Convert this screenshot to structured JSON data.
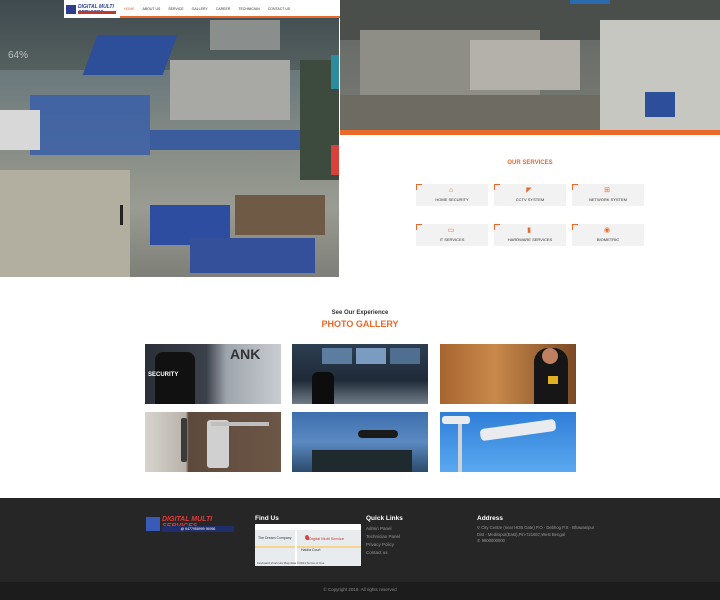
{
  "nav": {
    "logo_text": "DIGITAL MULTI SERVICES",
    "links": [
      "HOME",
      "ABOUT US",
      "SERVICE",
      "GALLERY",
      "CAREER",
      "TECHNICIAN",
      "CONTACT US"
    ]
  },
  "hero": {
    "slider_progress": "64%"
  },
  "services": {
    "title": "OUR SERVICES",
    "items": [
      {
        "label": "HOME SECURITY",
        "icon": "home-icon"
      },
      {
        "label": "CCTV SYSTEM",
        "icon": "cctv-icon"
      },
      {
        "label": "NETWORK SYSTEM",
        "icon": "network-icon"
      },
      {
        "label": "IT SERVICES",
        "icon": "monitor-icon"
      },
      {
        "label": "HARDWARE SERVICES",
        "icon": "hardware-icon"
      },
      {
        "label": "BIOMETRIC",
        "icon": "fingerprint-icon"
      }
    ]
  },
  "gallery": {
    "subtitle": "See Our Experience",
    "title": "PHOTO GALLERY",
    "images": [
      {
        "alt": "security guard pointing"
      },
      {
        "alt": "cctv control room"
      },
      {
        "alt": "female security officer"
      },
      {
        "alt": "digital door lock"
      },
      {
        "alt": "soldiers and helicopter"
      },
      {
        "alt": "cctv cameras"
      }
    ]
  },
  "footer": {
    "logo_text": "DIGITAL MULTI SERVICES",
    "logo_tagline": "@ 9477958999 95956",
    "find_us_title": "Find Us",
    "map_labels": {
      "marker": "Digital Multi Service",
      "place1": "The Dream Company",
      "place2": "Haldia Court",
      "bottom": "Keyboard shortcuts   Map data ©2021   Terms of Use"
    },
    "quick_links_title": "Quick Links",
    "quick_links": [
      "Admin Panel",
      "Technician Panel",
      "Privacy Policy",
      "Contact us"
    ],
    "address_title": "Address",
    "address_text": "City Centre (near HDB Gate) P.O - Debhog P.S - Bhawanipur Dist - Medinipur(East),Pin-721657,West Bengal",
    "phone": "9800000000",
    "copyright": "© Copyright 2019. All rights reserved"
  },
  "colors": {
    "accent": "#e8692a",
    "footer_bg": "#262626",
    "brand_blue": "#2d3f8c"
  }
}
